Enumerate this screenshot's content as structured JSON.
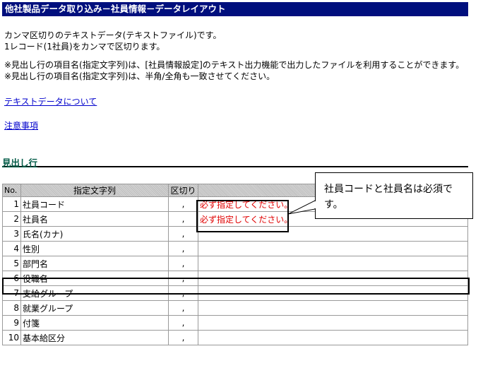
{
  "header": {
    "title": "他社製品データ取り込み－社員情報－データレイアウト"
  },
  "intro": {
    "line1": "カンマ区切りのテキストデータ(テキストファイル)です。",
    "line2": "1レコード(1社員)をカンマで区切ります。",
    "note1": "※見出し行の項目名(指定文字列)は、[社員情報設定]のテキスト出力機能で出力したファイルを利用することができます。",
    "note2": "※見出し行の項目名(指定文字列)は、半角/全角も一致させてください。"
  },
  "links": {
    "text_data": "テキストデータについて",
    "notes": "注意事項"
  },
  "section": {
    "heading": "見出し行"
  },
  "table": {
    "headers": {
      "no": "No.",
      "field": "指定文字列",
      "sep": "区切り",
      "note": ""
    },
    "rows": [
      {
        "no": "1",
        "field": "社員コード",
        "sep": ",",
        "note": "必ず指定してください。"
      },
      {
        "no": "2",
        "field": "社員名",
        "sep": ",",
        "note": "必ず指定してください。"
      },
      {
        "no": "3",
        "field": "氏名(カナ)",
        "sep": ",",
        "note": ""
      },
      {
        "no": "4",
        "field": "性別",
        "sep": ",",
        "note": ""
      },
      {
        "no": "5",
        "field": "部門名",
        "sep": ",",
        "note": ""
      },
      {
        "no": "6",
        "field": "役職名",
        "sep": ",",
        "note": ""
      },
      {
        "no": "7",
        "field": "支給グループ",
        "sep": ",",
        "note": ""
      },
      {
        "no": "8",
        "field": "就業グループ",
        "sep": ",",
        "note": ""
      },
      {
        "no": "9",
        "field": "付箋",
        "sep": ",",
        "note": ""
      },
      {
        "no": "10",
        "field": "基本給区分",
        "sep": ",",
        "note": ""
      }
    ]
  },
  "callout": {
    "text": "社員コードと社員名は必須です。"
  },
  "colors": {
    "titlebar": "#000f7d",
    "required_note": "#e00000",
    "section_heading": "#005a46"
  }
}
